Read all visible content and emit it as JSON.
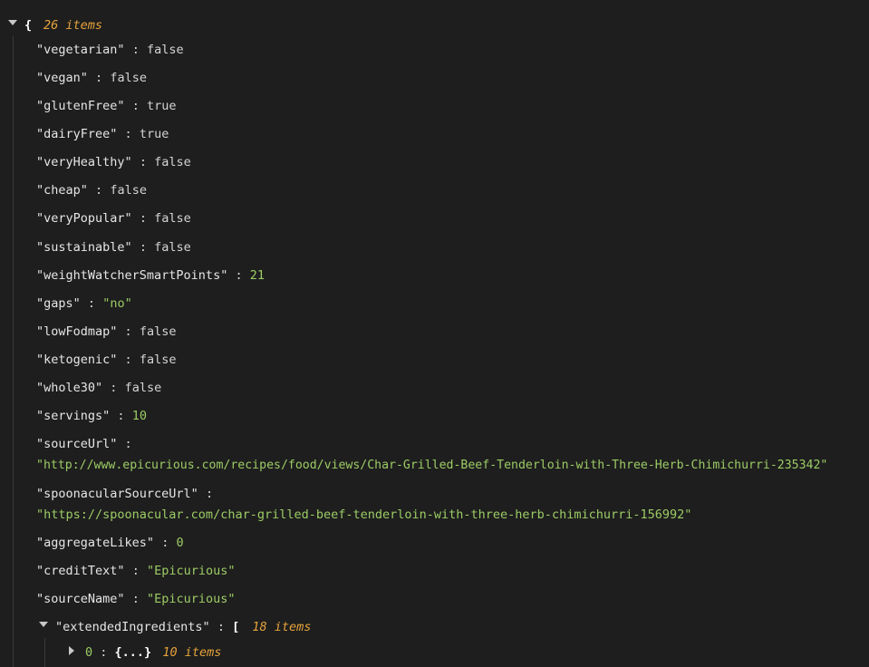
{
  "root": {
    "open_brace": "{",
    "count": "26 items"
  },
  "entries": [
    {
      "key": "\"vegetarian\"",
      "value": "false",
      "type": "bool"
    },
    {
      "key": "\"vegan\"",
      "value": "false",
      "type": "bool"
    },
    {
      "key": "\"glutenFree\"",
      "value": "true",
      "type": "bool"
    },
    {
      "key": "\"dairyFree\"",
      "value": "true",
      "type": "bool"
    },
    {
      "key": "\"veryHealthy\"",
      "value": "false",
      "type": "bool"
    },
    {
      "key": "\"cheap\"",
      "value": "false",
      "type": "bool"
    },
    {
      "key": "\"veryPopular\"",
      "value": "false",
      "type": "bool"
    },
    {
      "key": "\"sustainable\"",
      "value": "false",
      "type": "bool"
    },
    {
      "key": "\"weightWatcherSmartPoints\"",
      "value": "21",
      "type": "num"
    },
    {
      "key": "\"gaps\"",
      "value": "\"no\"",
      "type": "str"
    },
    {
      "key": "\"lowFodmap\"",
      "value": "false",
      "type": "bool"
    },
    {
      "key": "\"ketogenic\"",
      "value": "false",
      "type": "bool"
    },
    {
      "key": "\"whole30\"",
      "value": "false",
      "type": "bool"
    },
    {
      "key": "\"servings\"",
      "value": "10",
      "type": "num"
    },
    {
      "key": "\"sourceUrl\"",
      "value": "\"http://www.epicurious.com/recipes/food/views/Char-Grilled-Beef-Tenderloin-with-Three-Herb-Chimichurri-235342\"",
      "type": "str"
    },
    {
      "key": "\"spoonacularSourceUrl\"",
      "value": "\"https://spoonacular.com/char-grilled-beef-tenderloin-with-three-herb-chimichurri-156992\"",
      "type": "str"
    },
    {
      "key": "\"aggregateLikes\"",
      "value": "0",
      "type": "num"
    },
    {
      "key": "\"creditText\"",
      "value": "\"Epicurious\"",
      "type": "str"
    },
    {
      "key": "\"sourceName\"",
      "value": "\"Epicurious\"",
      "type": "str"
    }
  ],
  "extended": {
    "key": "\"extendedIngredients\"",
    "open_bracket": "[",
    "count": "18 items",
    "child": {
      "index": "0",
      "collapsed": "{...}",
      "count": "10 items"
    }
  },
  "colon": ":",
  "colors": {
    "background": "#1e1e1e",
    "key": "#e6e6e6",
    "string": "#9ccc65",
    "number": "#9ccc65",
    "count": "#e5a33b"
  }
}
